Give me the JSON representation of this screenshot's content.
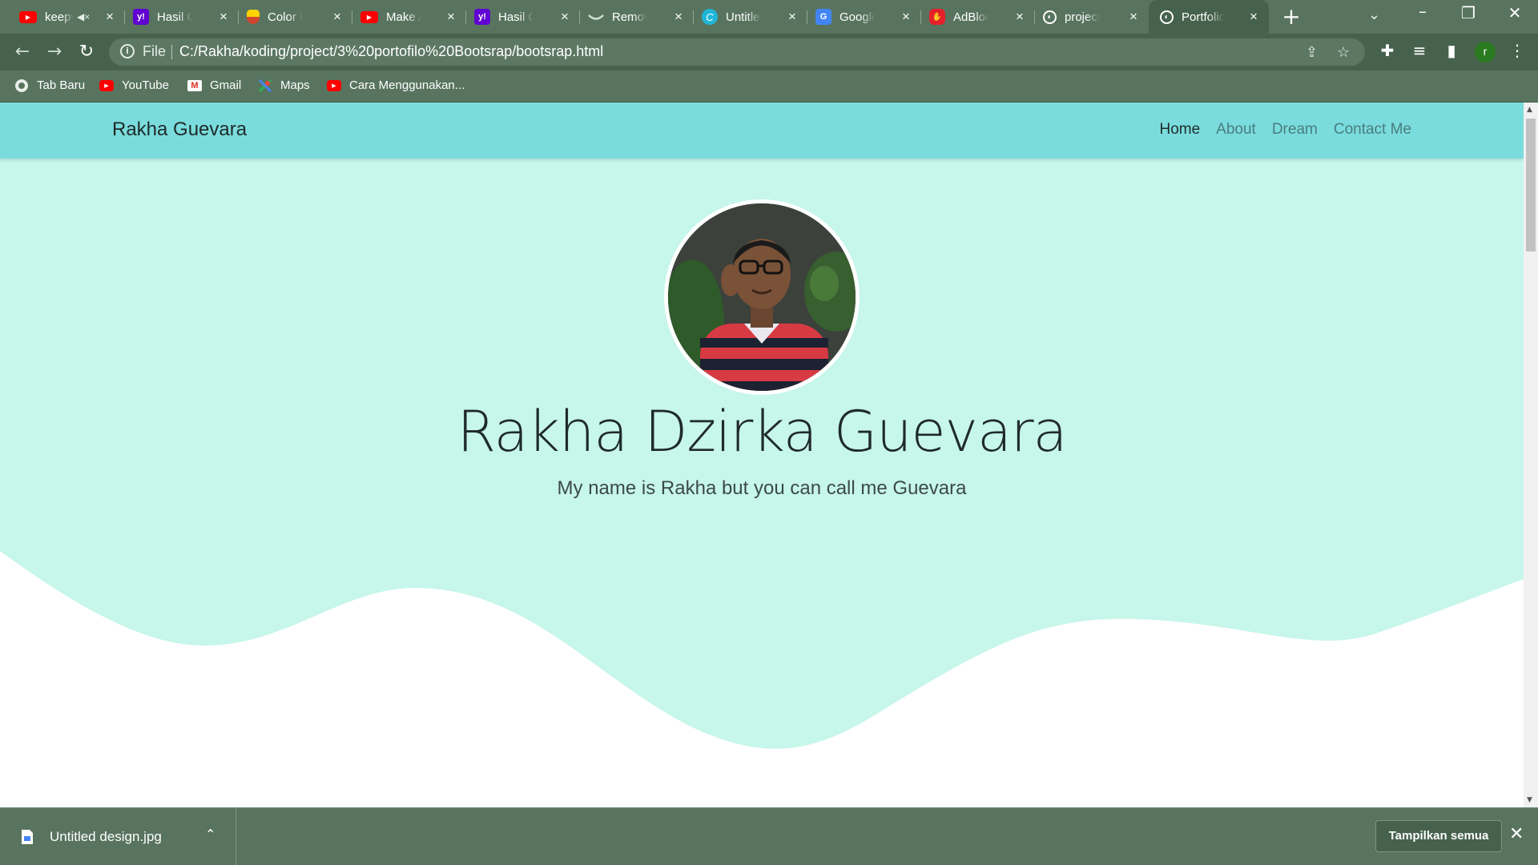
{
  "browser": {
    "tabs": [
      {
        "title": "keepy",
        "icon": "youtube-icon",
        "muted": true
      },
      {
        "title": "Hasil Cari",
        "icon": "yahoo-icon"
      },
      {
        "title": "Color Pal",
        "icon": "palette-icon"
      },
      {
        "title": "Make An",
        "icon": "youtube-icon"
      },
      {
        "title": "Hasil Cari",
        "icon": "yahoo-icon"
      },
      {
        "title": "Remove",
        "icon": "remove-bg-icon"
      },
      {
        "title": "Untitled",
        "icon": "canva-icon"
      },
      {
        "title": "Google T",
        "icon": "google-translate-icon"
      },
      {
        "title": "AdBlock",
        "icon": "adblock-icon"
      },
      {
        "title": "project P",
        "icon": "globe-icon"
      },
      {
        "title": "Portfolio",
        "icon": "globe-icon",
        "active": true
      }
    ],
    "address": {
      "scheme_label": "File",
      "url": "C:/Rakha/koding/project/3%20portofilo%20Bootsrap/bootsrap.html"
    },
    "profile_initial": "r",
    "bookmarks": [
      {
        "label": "Tab Baru",
        "icon": "chrome-icon"
      },
      {
        "label": "YouTube",
        "icon": "youtube-icon"
      },
      {
        "label": "Gmail",
        "icon": "gmail-icon"
      },
      {
        "label": "Maps",
        "icon": "maps-icon"
      },
      {
        "label": "Cara Menggunakan...",
        "icon": "youtube-icon"
      }
    ]
  },
  "page": {
    "navbar": {
      "brand": "Rakha Guevara",
      "links": [
        {
          "label": "Home",
          "active": true
        },
        {
          "label": "About"
        },
        {
          "label": "Dream"
        },
        {
          "label": "Contact Me"
        }
      ]
    },
    "hero": {
      "title": "Rakha Dzirka Guevara",
      "subtitle": "My name is Rakha but you can call me Guevara"
    },
    "colors": {
      "navbar": "#7adcdc",
      "hero": "#c7f6ea",
      "chrome": "#58745f"
    }
  },
  "downloads": {
    "file_name": "Untitled design.jpg",
    "show_all_label": "Tampilkan semua"
  }
}
